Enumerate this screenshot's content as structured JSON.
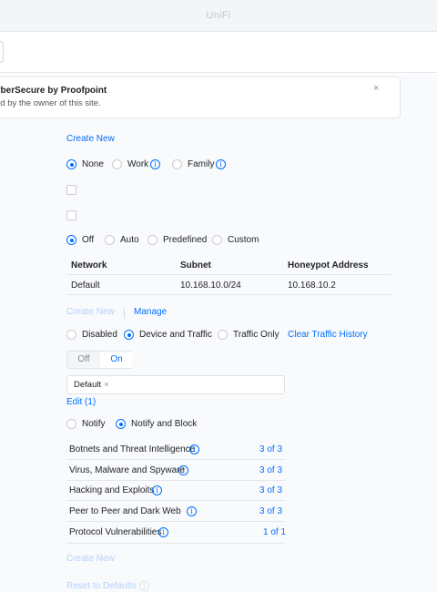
{
  "app": {
    "brand": "UniFi"
  },
  "banner": {
    "title": "yberSecure by Proofpoint",
    "text": "ed by the owner of this site.",
    "close_icon": "×"
  },
  "create_new_top": "Create New",
  "profile_options": {
    "none": "None",
    "work": "Work",
    "family": "Family",
    "selected": "None"
  },
  "honeypot_mode": {
    "off": "Off",
    "auto": "Auto",
    "predefined": "Predefined",
    "custom": "Custom",
    "selected": "Off"
  },
  "honeypot_table": {
    "headers": [
      "Network",
      "Subnet",
      "Honeypot Address"
    ],
    "rows": [
      {
        "network": "Default",
        "subnet": "10.168.10.0/24",
        "address": "10.168.10.2"
      }
    ]
  },
  "create_new_mid": "Create New",
  "manage": "Manage",
  "traffic_logging": {
    "disabled": "Disabled",
    "device_and_traffic": "Device and Traffic",
    "traffic_only": "Traffic Only",
    "clear_history": "Clear Traffic History",
    "selected": "Device and Traffic"
  },
  "toggle": {
    "off": "Off",
    "on": "On",
    "selected": "On"
  },
  "networks_tag": {
    "label": "Default",
    "remove": "×"
  },
  "edit_link": "Edit (1)",
  "ips_mode": {
    "notify": "Notify",
    "notify_block": "Notify and Block",
    "selected": "Notify and Block"
  },
  "categories": [
    {
      "name": "Botnets and Threat Intelligence",
      "count": "3 of 3"
    },
    {
      "name": "Virus, Malware and Spyware",
      "count": "3 of 3"
    },
    {
      "name": "Hacking and Exploits",
      "count": "3 of 3"
    },
    {
      "name": "Peer to Peer and Dark Web",
      "count": "3 of 3"
    },
    {
      "name": "Protocol Vulnerabilities",
      "count": "1 of 1"
    }
  ],
  "create_new_bottom": "Create New",
  "reset_defaults": "Reset to Defaults",
  "colors": {
    "accent": "#006fff",
    "text": "#212327",
    "muted": "#808893",
    "faded_link": "#b3d0ff"
  }
}
